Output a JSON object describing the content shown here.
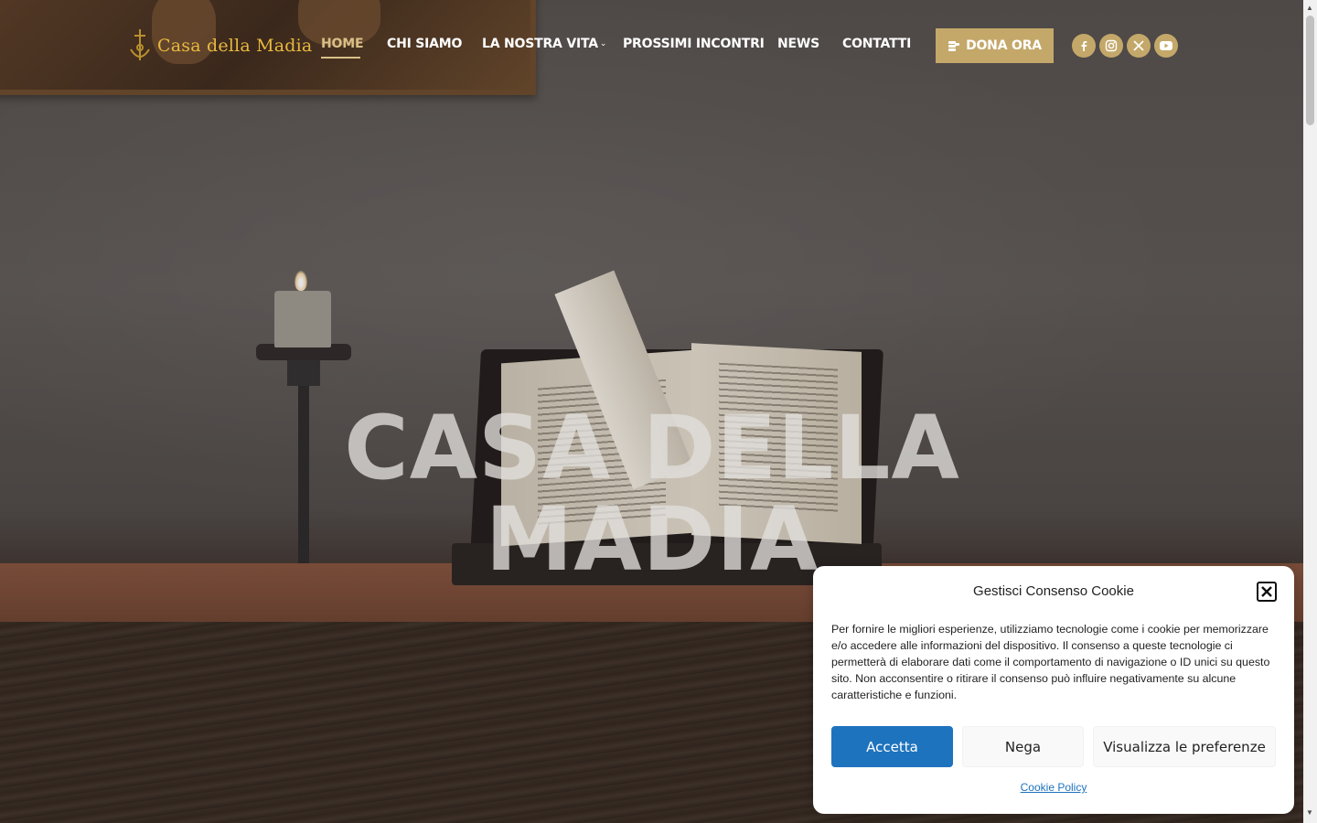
{
  "brand": {
    "name": "Casa della Madia",
    "color": "#e9b93f"
  },
  "nav": {
    "items": [
      {
        "label": "HOME",
        "active": true
      },
      {
        "label": "CHI SIAMO"
      },
      {
        "label": "LA NOSTRA VITA",
        "has_dropdown": true
      },
      {
        "label": "PROSSIMI INCONTRI"
      },
      {
        "label": "NEWS"
      },
      {
        "label": "CONTATTI"
      }
    ],
    "active_color": "#d9bf87",
    "donate_label": "DONA ORA",
    "donate_icon": "coins-icon",
    "accent": "#c4a86a",
    "social": [
      "facebook-icon",
      "instagram-icon",
      "x-icon",
      "youtube-icon"
    ]
  },
  "hero": {
    "title_line1": "CASA DELLA",
    "title_line2": "MADIA"
  },
  "cookie": {
    "title": "Gestisci Consenso Cookie",
    "text": "Per fornire le migliori esperienze, utilizziamo tecnologie come i cookie per memorizzare e/o accedere alle informazioni del dispositivo. Il consenso a queste tecnologie ci permetterà di elaborare dati come il comportamento di navigazione o ID unici su questo sito. Non acconsentire o ritirare il consenso può influire negativamente su alcune caratteristiche e funzioni.",
    "accept_label": "Accetta",
    "deny_label": "Nega",
    "prefs_label": "Visualizza le preferenze",
    "policy_label": "Cookie Policy",
    "accept_color": "#1e73be"
  }
}
